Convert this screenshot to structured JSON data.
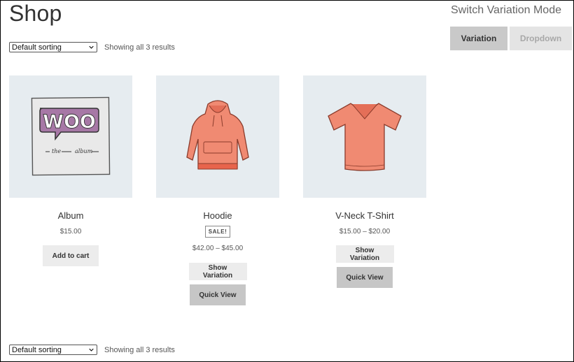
{
  "page": {
    "title": "Shop"
  },
  "ordering": {
    "selected": "Default sorting",
    "result_count": "Showing all 3 results"
  },
  "variation_mode": {
    "title": "Switch Variation Mode",
    "options": [
      "Variation",
      "Dropdown"
    ],
    "active": "Variation"
  },
  "products": [
    {
      "name": "Album",
      "price": "$15.00",
      "sale": false,
      "buttons": {
        "primary": "Add to cart"
      },
      "image_icon": "woo-album-icon"
    },
    {
      "name": "Hoodie",
      "sale_label": "SALE!",
      "price": "$42.00 – $45.00",
      "buttons": {
        "show_variation": "Show Variation",
        "quick_view": "Quick View"
      },
      "image_icon": "hoodie-icon"
    },
    {
      "name": "V-Neck T-Shirt",
      "price": "$15.00 – $20.00",
      "buttons": {
        "show_variation": "Show Variation",
        "quick_view": "Quick View"
      },
      "image_icon": "vneck-tshirt-icon"
    }
  ],
  "colors": {
    "thumb_bg": "#e6ecf0",
    "active_mode": "#c9c9c9",
    "inactive_mode": "#e4e4e4",
    "apparel": "#f08a72"
  }
}
